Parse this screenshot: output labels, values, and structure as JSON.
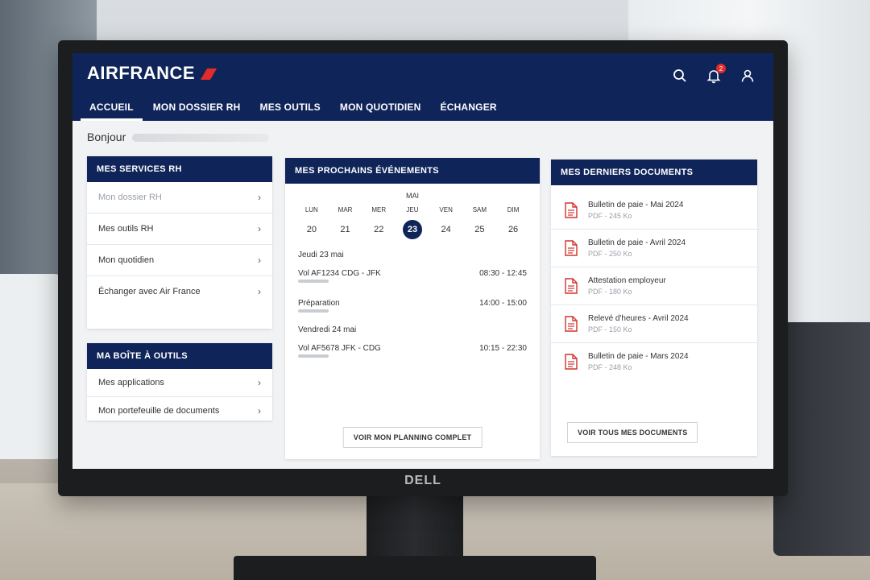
{
  "header": {
    "logo": "AIRFRANCE",
    "notification_count": "2",
    "nav": [
      {
        "label": "ACCUEIL",
        "active": true
      },
      {
        "label": "MON DOSSIER RH"
      },
      {
        "label": "MES OUTILS"
      },
      {
        "label": "MON QUOTIDIEN"
      },
      {
        "label": "ÉCHANGER"
      }
    ]
  },
  "greeting": "Bonjour",
  "services": {
    "title": "MES SERVICES RH",
    "items": [
      {
        "label": "Mon dossier RH"
      },
      {
        "label": "Mes outils RH"
      },
      {
        "label": "Mon quotidien"
      },
      {
        "label": "Échanger avec Air France"
      }
    ]
  },
  "toolbox": {
    "title": "MA BOÎTE À OUTILS",
    "items": [
      {
        "label": "Mes applications"
      },
      {
        "label": "Mon portefeuille de documents"
      }
    ]
  },
  "events": {
    "title": "MES PROCHAINS ÉVÉNEMENTS",
    "month": "MAI",
    "days": [
      {
        "name": "LUN",
        "num": "20"
      },
      {
        "name": "MAR",
        "num": "21"
      },
      {
        "name": "MER",
        "num": "22"
      },
      {
        "name": "JEU",
        "num": "23",
        "selected": true
      },
      {
        "name": "VEN",
        "num": "24"
      },
      {
        "name": "SAM",
        "num": "25"
      },
      {
        "name": "DIM",
        "num": "26"
      }
    ],
    "groups": [
      {
        "date": "Jeudi 23 mai",
        "items": [
          {
            "title": "Vol AF1234 CDG - JFK",
            "time": "08:30 - 12:45"
          },
          {
            "title": "Préparation",
            "time": "14:00 - 15:00"
          }
        ]
      },
      {
        "date": "Vendredi 24 mai",
        "items": [
          {
            "title": "Vol AF5678 JFK - CDG",
            "time": "10:15 - 22:30"
          }
        ]
      }
    ],
    "button": "VOIR MON PLANNING COMPLET"
  },
  "documents": {
    "title": "MES DERNIERS DOCUMENTS",
    "items": [
      {
        "title": "Bulletin de paie - Mai 2024",
        "meta": "PDF - 245 Ko"
      },
      {
        "title": "Bulletin de paie - Avril 2024",
        "meta": "PDF - 250 Ko"
      },
      {
        "title": "Attestation employeur",
        "meta": "PDF - 180 Ko"
      },
      {
        "title": "Relevé d'heures - Avril 2024",
        "meta": "PDF - 150 Ko"
      },
      {
        "title": "Bulletin de paie - Mars 2024",
        "meta": "PDF - 248 Ko"
      }
    ],
    "button": "VOIR TOUS MES DOCUMENTS"
  },
  "monitor": {
    "brand": "DELL"
  },
  "colors": {
    "brand_navy": "#0f2459",
    "accent_red": "#e22b2b"
  }
}
